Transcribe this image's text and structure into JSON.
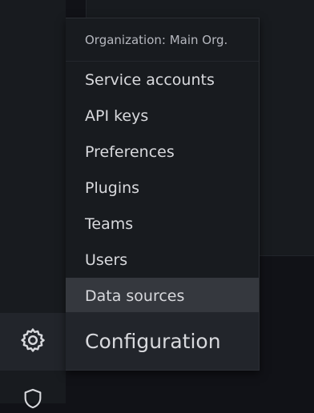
{
  "menu": {
    "header": "Organization: Main Org.",
    "items": [
      {
        "label": "Service accounts"
      },
      {
        "label": "API keys"
      },
      {
        "label": "Preferences"
      },
      {
        "label": "Plugins"
      },
      {
        "label": "Teams"
      },
      {
        "label": "Users"
      },
      {
        "label": "Data sources",
        "active": true
      }
    ],
    "footer": "Configuration"
  },
  "sidebar": {
    "icons": [
      "gear-icon",
      "shield-icon"
    ]
  },
  "colors": {
    "background": "#111217",
    "panel": "#181b1f",
    "hover": "#35383e",
    "text": "#d8d9dd",
    "muted_text": "#b6b8bf"
  }
}
